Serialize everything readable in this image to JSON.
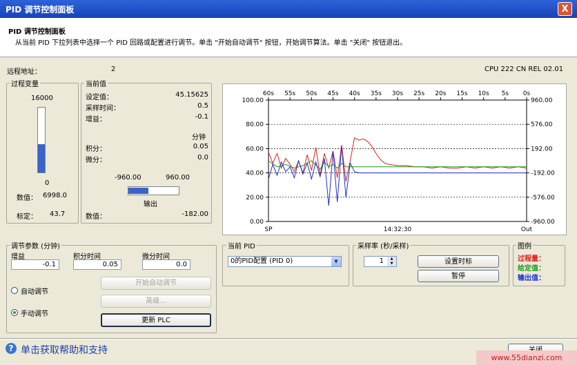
{
  "window": {
    "title": "PID 调节控制面板",
    "close_glyph": "X"
  },
  "header": {
    "heading": "PID 调节控制面板",
    "description": "从当前 PID 下拉列表中选择一个 PID 回路或配置进行调节。单击 \"开始自动调节\" 按钮，开始调节算法。单击 \"关闭\" 按钮退出。"
  },
  "remote": {
    "label": "远程地址：",
    "value": "2",
    "cpu": "CPU 222 CN REL 02.01"
  },
  "process_var": {
    "title": "过程变量",
    "max": "16000",
    "min": "0",
    "fill_fraction": 0.44,
    "value_label": "数值：",
    "value": "6998.0",
    "scale_label": "标定：",
    "scale": "43.7"
  },
  "current": {
    "title": "当前值",
    "setpoint_label": "设定值：",
    "setpoint": "45.15625",
    "sample_label": "采样时间：",
    "sample": "0.5",
    "gain_label": "增益：",
    "gain": "-0.1",
    "minutes_label": "分钟",
    "integral_label": "积分：",
    "integral": "0.05",
    "derivative_label": "微分：",
    "derivative": "0.0",
    "out_min": "-960.00",
    "out_max": "960.00",
    "out_fill_fraction": 0.4,
    "output_label": "输出",
    "value_label": "数值：",
    "value": "-182.00"
  },
  "tuning": {
    "title": "调节参数 (分钟)",
    "gain_label": "增益",
    "gain": "-0.1",
    "integral_label": "积分时间",
    "integral": "0.05",
    "derivative_label": "微分时间",
    "derivative": "0.0",
    "auto_label": "自动调节",
    "manual_label": "手动调节",
    "start_auto": "开始自动调节",
    "advanced": "高级...",
    "update_plc": "更新 PLC"
  },
  "current_pid": {
    "title": "当前 PID",
    "selected": "0的PID配置 (PID 0)"
  },
  "sample_rate": {
    "title": "采样率 (秒/采样)",
    "value": "1",
    "set_marker": "设置时标",
    "pause": "暂停"
  },
  "legend": {
    "title": "图例",
    "pv": "过程量：",
    "pv_color": "#e0201c",
    "sp": "给定值：",
    "sp_color": "#1a9a1a",
    "out": "输出值：",
    "out_color": "#1c2fd0"
  },
  "footer": {
    "help": "单击获取帮助和支持",
    "close": "关闭",
    "watermark": "www.55dianzi.com"
  },
  "chart_data": {
    "type": "line",
    "x_ticks": [
      "60s",
      "55s",
      "50s",
      "45s",
      "40s",
      "35s",
      "30s",
      "25s",
      "20s",
      "15s",
      "10s",
      "5s",
      "0s"
    ],
    "y_left_ticks": [
      "100.00",
      "80.00",
      "60.00",
      "40.00",
      "20.00",
      "0.00"
    ],
    "y_right_ticks": [
      "960.00",
      "576.00",
      "192.00",
      "-192.00",
      "-576.00",
      "-960.00"
    ],
    "ylim_left": [
      0,
      100
    ],
    "ylim_right": [
      -960,
      960
    ],
    "x_bottom_left": "SP",
    "x_bottom_center": "14:32:30",
    "x_bottom_right": "Out",
    "grid": "dashed-horizontal",
    "series": [
      {
        "name": "过程量",
        "color": "#e0201c",
        "x": [
          60,
          59,
          58,
          57,
          56,
          55,
          54,
          53,
          52,
          51,
          50,
          49,
          48,
          47,
          46,
          45,
          44,
          43,
          42,
          41,
          40,
          39,
          38,
          37,
          36,
          35,
          34,
          33,
          32,
          30,
          28,
          26,
          24,
          22,
          20,
          18,
          16,
          14,
          12,
          10,
          8,
          6,
          4,
          2,
          0
        ],
        "y": [
          57,
          48,
          56,
          44,
          52,
          47,
          41,
          50,
          40,
          55,
          42,
          61,
          38,
          56,
          44,
          58,
          36,
          63,
          33,
          50,
          69,
          67,
          68,
          66,
          62,
          56,
          51,
          48,
          47,
          46,
          46,
          45,
          45,
          44,
          45,
          44,
          44,
          45,
          44,
          45,
          44,
          45,
          44,
          45,
          44
        ]
      },
      {
        "name": "给定值",
        "color": "#1a9a1a",
        "x": [
          60,
          58,
          56,
          54,
          52,
          50,
          48,
          47,
          46,
          45,
          44,
          43,
          42,
          41,
          40,
          35,
          30,
          25,
          20,
          15,
          10,
          5,
          0
        ],
        "y": [
          50,
          45,
          47,
          44,
          46,
          50,
          43,
          49,
          45,
          47,
          44,
          48,
          45,
          45,
          45,
          45,
          45,
          45,
          45,
          45,
          45,
          45,
          45
        ]
      },
      {
        "name": "输出值",
        "color": "#1c2fd0",
        "x": [
          60,
          59,
          58,
          57,
          56,
          55,
          54,
          53,
          52,
          51,
          50,
          49,
          48,
          47,
          46,
          45,
          44,
          43,
          42,
          41,
          40,
          39,
          38,
          36,
          34,
          30,
          25,
          20,
          15,
          10,
          5,
          0
        ],
        "y": [
          35,
          47,
          38,
          49,
          41,
          45,
          36,
          50,
          39,
          48,
          35,
          49,
          37,
          52,
          13,
          58,
          16,
          62,
          20,
          48,
          41,
          40,
          40,
          40,
          40,
          40,
          40,
          40,
          40,
          40,
          40,
          40
        ]
      }
    ]
  }
}
